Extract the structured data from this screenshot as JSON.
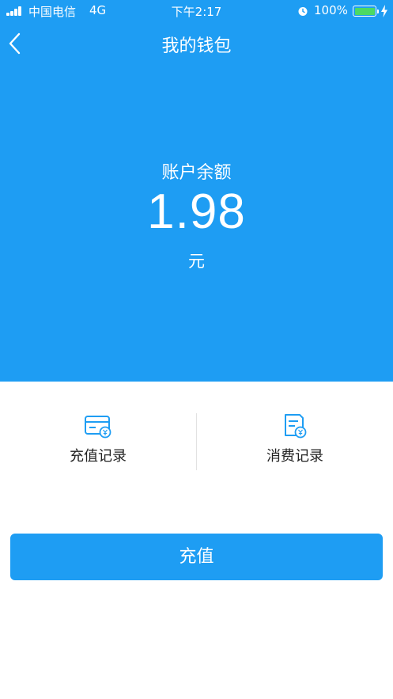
{
  "status_bar": {
    "carrier": "中国电信",
    "network": "4G",
    "time": "下午2:17",
    "battery": "100%"
  },
  "nav": {
    "title": "我的钱包"
  },
  "balance": {
    "label": "账户余额",
    "value": "1.98",
    "unit": "元"
  },
  "records": [
    {
      "label": "充值记录",
      "icon": "card-yuan-icon"
    },
    {
      "label": "消费记录",
      "icon": "receipt-yuan-icon"
    }
  ],
  "actions": {
    "recharge_label": "充值"
  },
  "colors": {
    "primary": "#1e9df3",
    "battery": "#4cd964"
  }
}
